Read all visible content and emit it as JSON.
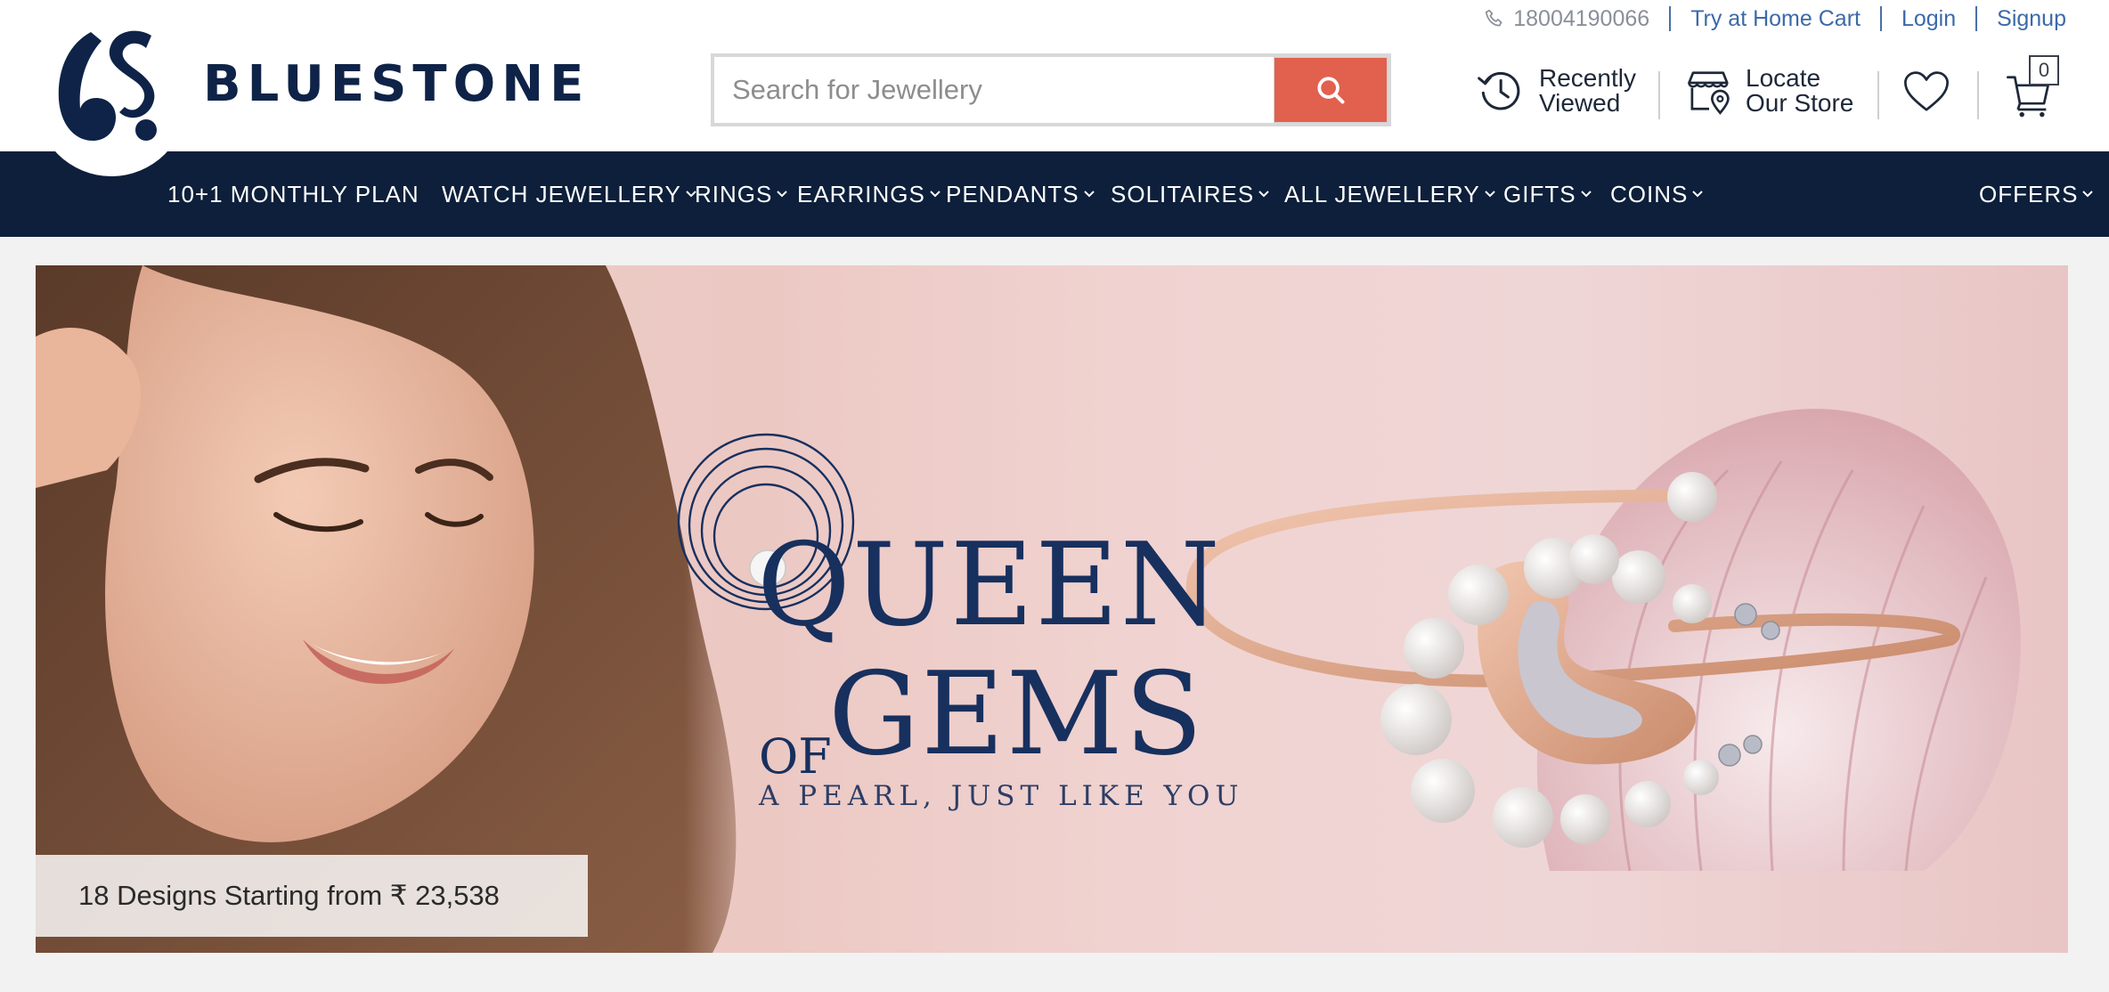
{
  "topbar": {
    "phone": "18004190066",
    "links": [
      "Try at Home Cart",
      "Login",
      "Signup"
    ]
  },
  "brand": {
    "name": "BLUESTONE"
  },
  "search": {
    "placeholder": "Search for Jewellery"
  },
  "quick_links": {
    "recently_viewed": [
      "Recently",
      "Viewed"
    ],
    "locate_store": [
      "Locate",
      "Our Store"
    ],
    "cart_count": "0"
  },
  "nav": {
    "items": [
      "10+1 MONTHLY PLAN",
      "WATCH JEWELLERY",
      "RINGS",
      "EARRINGS",
      "PENDANTS",
      "SOLITAIRES",
      "ALL JEWELLERY",
      "GIFTS",
      "COINS",
      "OFFERS"
    ]
  },
  "banner": {
    "headline_line1": "QUEEN",
    "headline_of": "OF",
    "headline_line2": "GEMS",
    "tagline": "A PEARL, JUST LIKE YOU",
    "designs_text": "18 Designs Starting from ₹ 23,538"
  },
  "colors": {
    "brand_navy": "#0d1f3a",
    "search_button": "#e2604e",
    "link_blue": "#3b6aa8"
  }
}
